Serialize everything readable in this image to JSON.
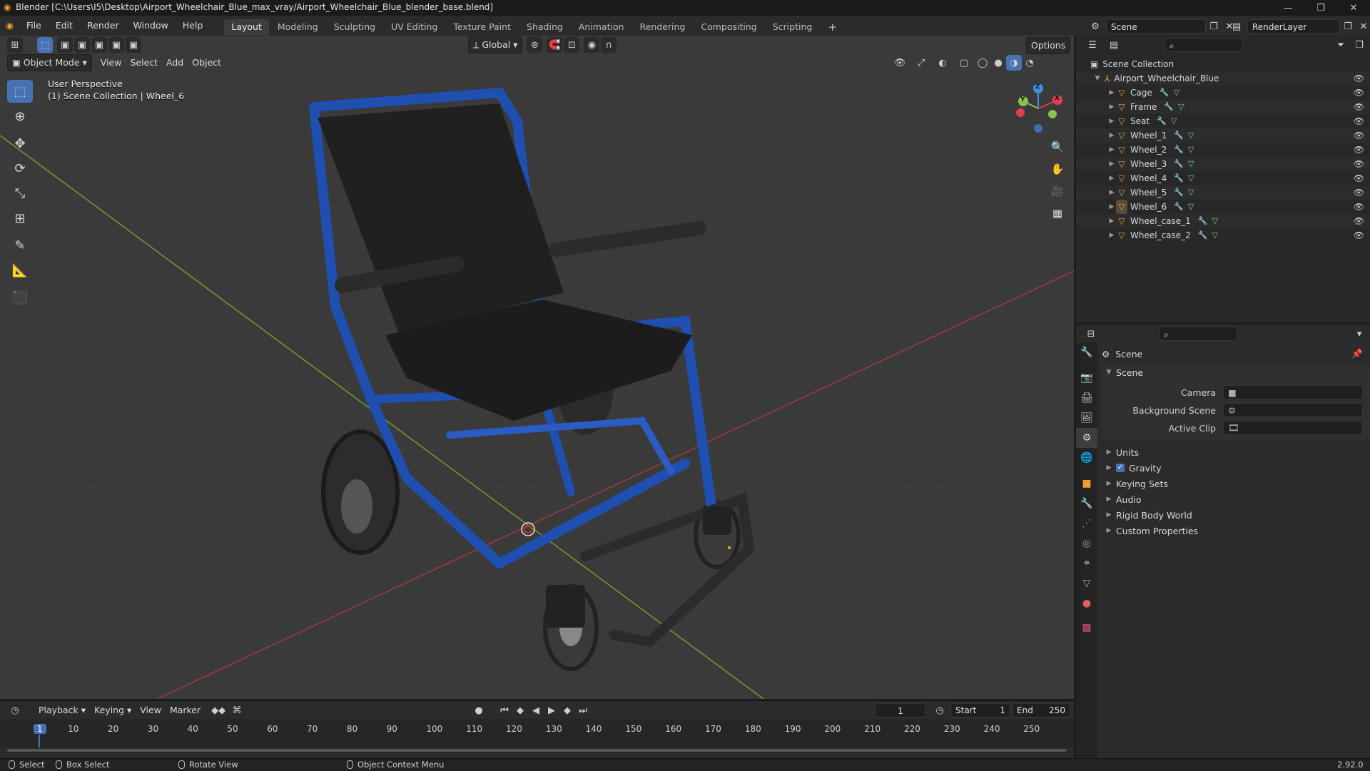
{
  "window": {
    "title": "Blender [C:\\Users\\I5\\Desktop\\Airport_Wheelchair_Blue_max_vray/Airport_Wheelchair_Blue_blender_base.blend]",
    "min_icon": "minimize-icon",
    "max_icon": "maximize-icon",
    "close_icon": "close-icon"
  },
  "menu": [
    "File",
    "Edit",
    "Render",
    "Window",
    "Help"
  ],
  "workspaces": [
    "Layout",
    "Modeling",
    "Sculpting",
    "UV Editing",
    "Texture Paint",
    "Shading",
    "Animation",
    "Rendering",
    "Compositing",
    "Scripting"
  ],
  "active_workspace": "Layout",
  "scene_selector": {
    "scene": "Scene",
    "view_layer": "RenderLayer"
  },
  "viewport": {
    "transform_orientation": "Global",
    "options_label": "Options",
    "mode": "Object Mode",
    "menus": [
      "View",
      "Select",
      "Add",
      "Object"
    ],
    "overlay_line1": "User Perspective",
    "overlay_line2": "(1) Scene Collection | Wheel_6",
    "gizmo": {
      "x": "X",
      "y": "Y",
      "z": "Z"
    },
    "tools": [
      "select-box-icon",
      "cursor-icon",
      "move-icon",
      "rotate-icon",
      "scale-icon",
      "transform-icon",
      "annotate-icon",
      "measure-icon",
      "add-cube-icon"
    ]
  },
  "outliner": {
    "root": "Scene Collection",
    "collection": "Airport_Wheelchair_Blue",
    "objects": [
      "Cage",
      "Frame",
      "Seat",
      "Wheel_1",
      "Wheel_2",
      "Wheel_3",
      "Wheel_4",
      "Wheel_5",
      "Wheel_6",
      "Wheel_case_1",
      "Wheel_case_2"
    ],
    "active_object": "Wheel_6"
  },
  "properties": {
    "header": "Scene",
    "panel": "Scene",
    "fields": [
      {
        "label": "Camera",
        "value": ""
      },
      {
        "label": "Background Scene",
        "value": ""
      },
      {
        "label": "Active Clip",
        "value": ""
      }
    ],
    "subpanels": [
      "Units",
      "Gravity",
      "Keying Sets",
      "Audio",
      "Rigid Body World",
      "Custom Properties"
    ],
    "gravity_checked": true
  },
  "timeline": {
    "menus": [
      "Playback",
      "Keying",
      "View",
      "Marker"
    ],
    "current_frame": "1",
    "start_label": "Start",
    "start": "1",
    "end_label": "End",
    "end": "250",
    "ticks": [
      "1",
      "10",
      "20",
      "30",
      "40",
      "50",
      "60",
      "70",
      "80",
      "90",
      "100",
      "110",
      "120",
      "130",
      "140",
      "150",
      "160",
      "170",
      "180",
      "190",
      "200",
      "210",
      "220",
      "230",
      "240",
      "250"
    ]
  },
  "status": {
    "select": "Select",
    "box_select": "Box Select",
    "rotate_view": "Rotate View",
    "context_menu": "Object Context Menu",
    "version": "2.92.0"
  },
  "colors": {
    "accent": "#4772b3",
    "object_orange": "#f29d38",
    "axis_x": "#e0404a",
    "axis_y": "#8bc34a",
    "axis_z": "#3f8fe0"
  }
}
